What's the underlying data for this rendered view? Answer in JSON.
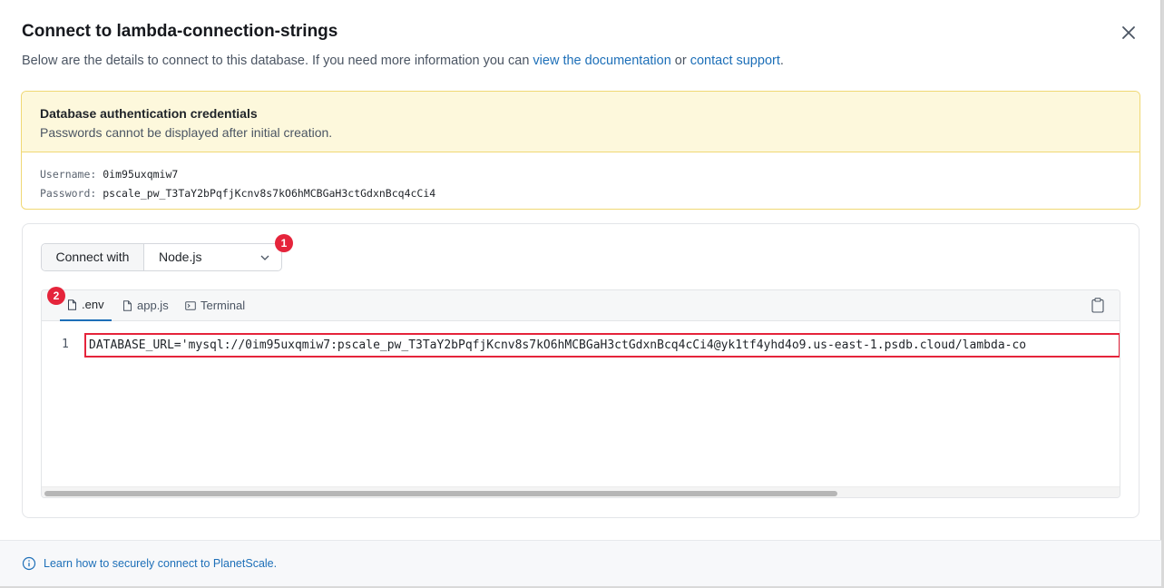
{
  "dialog": {
    "title": "Connect to lambda-connection-strings",
    "subtitle_prefix": "Below are the details to connect to this database. If you need more information you can ",
    "docs_link": "view the documentation",
    "subtitle_or": " or ",
    "support_link": "contact support",
    "subtitle_suffix": "."
  },
  "credentials": {
    "title": "Database authentication credentials",
    "subtitle": "Passwords cannot be displayed after initial creation.",
    "username_key": "Username:",
    "username_value": "0im95uxqmiw7",
    "password_key": "Password:",
    "password_value": "pscale_pw_T3TaY2bPqfjKcnv8s7kO6hMCBGaH3ctGdxnBcq4cCi4"
  },
  "connect": {
    "label": "Connect with",
    "selected": "Node.js"
  },
  "badges": {
    "one": "1",
    "two": "2"
  },
  "tabs": [
    {
      "label": ".env"
    },
    {
      "label": "app.js"
    },
    {
      "label": "Terminal"
    }
  ],
  "code": {
    "line_number": "1",
    "line": "DATABASE_URL='mysql://0im95uxqmiw7:pscale_pw_T3TaY2bPqfjKcnv8s7kO6hMCBGaH3ctGdxnBcq4cCi4@yk1tf4yhd4o9.us-east-1.psdb.cloud/lambda-co"
  },
  "footer": {
    "link": "Learn how to securely connect to PlanetScale."
  }
}
